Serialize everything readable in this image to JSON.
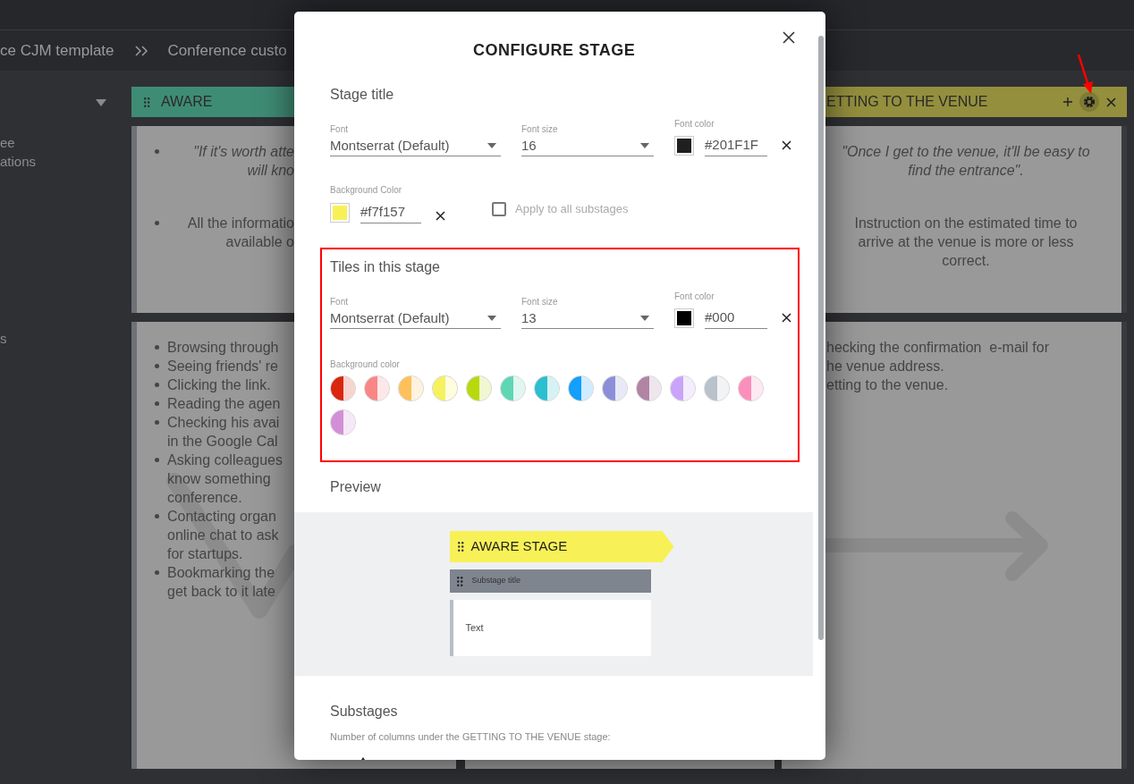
{
  "breadcrumb": [
    {
      "text": "ce CJM template"
    },
    {
      "text": "Conference custo"
    }
  ],
  "sidebar": {
    "items": [
      {
        "lines": [
          "ee",
          "ations"
        ]
      },
      {
        "lines": [
          "s"
        ]
      }
    ]
  },
  "stages": [
    {
      "title": "AWARE",
      "color": "#3f8c74",
      "tiles": [
        {
          "items": [
            {
              "kind": "quote",
              "lines": [
                "\"If it's worth atte",
                "will kno"
              ]
            },
            {
              "kind": "note",
              "lines": [
                "All the informatio",
                "available o"
              ]
            }
          ]
        },
        {
          "items": [
            {
              "kind": "note",
              "lines": [
                "Browsing through"
              ]
            },
            {
              "kind": "note",
              "lines": [
                "Seeing friends' re"
              ]
            },
            {
              "kind": "note",
              "lines": [
                "Clicking the link."
              ]
            },
            {
              "kind": "note",
              "lines": [
                "Reading the agen"
              ]
            },
            {
              "kind": "note",
              "lines": [
                "Checking his avai",
                "in the Google Cal"
              ]
            },
            {
              "kind": "note",
              "lines": [
                "Asking colleagues",
                "know something",
                "conference."
              ]
            },
            {
              "kind": "note",
              "lines": [
                "Contacting organ",
                "online chat to ask",
                "for startups."
              ]
            },
            {
              "kind": "note",
              "lines": [
                "Bookmarking the",
                "get back to it late"
              ]
            }
          ]
        }
      ]
    },
    {
      "title": "ETTING TO THE VENUE",
      "color": "#948f3d",
      "tiles": [
        {
          "items": [
            {
              "kind": "quote",
              "lines": [
                "\"Once I get to the venue, it'll be easy to",
                "find the entrance\"."
              ]
            },
            {
              "kind": "note",
              "lines": [
                "Instruction on the estimated time to",
                "arrive at the venue is more or less",
                "correct."
              ]
            }
          ]
        },
        {
          "items": [
            {
              "kind": "note",
              "lines": [
                "hecking the confirmation  e-mail for",
                "he venue address."
              ]
            },
            {
              "kind": "note",
              "lines": [
                "etting to the venue."
              ]
            }
          ]
        }
      ]
    }
  ],
  "dialog": {
    "title": "CONFIGURE STAGE",
    "stage_title": {
      "heading": "Stage title",
      "font": {
        "label": "Font",
        "value": "Montserrat (Default)"
      },
      "font_size": {
        "label": "Font size",
        "value": "16"
      },
      "font_color": {
        "label": "Font color",
        "value": "#201F1F",
        "color": "#201f1f"
      },
      "background": {
        "label": "Background Color",
        "value": "#f7f157",
        "color": "#f7f157"
      },
      "apply_all": {
        "label": "Apply to all substages",
        "checked": false
      }
    },
    "tiles": {
      "heading": "Tiles in this stage",
      "font": {
        "label": "Font",
        "value": "Montserrat (Default)"
      },
      "font_size": {
        "label": "Font size",
        "value": "13"
      },
      "font_color": {
        "label": "Font color",
        "value": "#000",
        "color": "#000000"
      },
      "background_label": "Background color",
      "swatches": [
        {
          "color": "#d9260f"
        },
        {
          "color": "#f88686"
        },
        {
          "color": "#fdc05a"
        },
        {
          "color": "#f6f15e"
        },
        {
          "color": "#b7d90e"
        },
        {
          "color": "#5fd6b4"
        },
        {
          "color": "#2bbfcf"
        },
        {
          "color": "#139ffc"
        },
        {
          "color": "#8c8fd8"
        },
        {
          "color": "#b184a4"
        },
        {
          "color": "#c9a4f9"
        },
        {
          "color": "#b9c1cb"
        },
        {
          "color": "#fc8ebb"
        },
        {
          "color": "#d28fd8"
        }
      ]
    },
    "preview": {
      "heading": "Preview",
      "stage_label": "AWARE STAGE",
      "substage_label": "Substage title",
      "tile_text": "Text"
    },
    "substages": {
      "heading": "Substages",
      "description": "Number of columns under the GETTING TO THE VENUE stage:"
    }
  }
}
